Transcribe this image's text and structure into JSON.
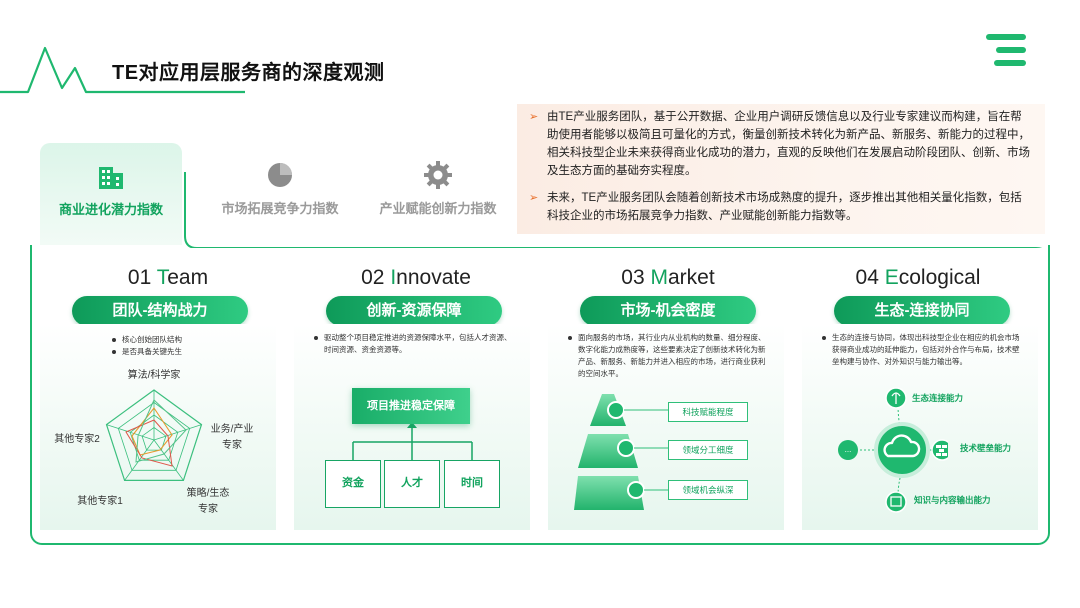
{
  "header": {
    "title": "TE对应用层服务商的深度观测"
  },
  "colors": {
    "brand_green": "#12a35e",
    "accent_orange": "#e86e2a",
    "inactive_gray": "#9a9a9a"
  },
  "tabs": [
    {
      "label": "商业进化潜力指数",
      "icon": "buildings-icon",
      "active": true
    },
    {
      "label": "市场拓展竞争力指数",
      "icon": "pie-chart-icon",
      "active": false
    },
    {
      "label": "产业赋能创新力指数",
      "icon": "gear-icon",
      "active": false
    }
  ],
  "info": {
    "paragraphs": [
      "由TE产业服务团队，基于公开数据、企业用户调研反馈信息以及行业专家建议而构建，旨在帮助使用者能够以极简且可量化的方式，衡量创新技术转化为新产品、新服务、新能力的过程中，相关科技型企业未来获得商业化成功的潜力，直观的反映他们在发展启动阶段团队、创新、市场及生态方面的基础夯实程度。",
      "未来，TE产业服务团队会随着创新技术市场成熟度的提升，逐步推出其他相关量化指数，包括科技企业的市场拓展竞争力指数、产业赋能创新能力指数等。"
    ]
  },
  "cards": [
    {
      "num": "01",
      "num_first": "T",
      "num_rest": "eam",
      "pill": "团队-结构战力",
      "bullets": [
        "核心创始团队结构",
        "是否具备关键先生"
      ],
      "radar_labels": [
        "算法/科学家",
        "业务/产业专家",
        "策略/生态专家",
        "其他专家1",
        "其他专家2"
      ]
    },
    {
      "num": "02",
      "num_first": "I",
      "num_rest": "nnovate",
      "pill": "创新-资源保障",
      "bullets": [
        "驱动整个项目稳定推进的资源保障水平，包括人才资源、时间资源、资金资源等。"
      ],
      "tree_top": "项目推进稳定保障",
      "tree_items": [
        "资金",
        "人才",
        "时间"
      ]
    },
    {
      "num": "03",
      "num_first": "M",
      "num_rest": "arket",
      "pill": "市场-机会密度",
      "bullets": [
        "面向服务的市场，其行业内从业机构的数量、细分程度、数字化能力成熟度等，这些要素决定了创新技术转化为新产品、新服务、新能力并进入相应的市场，进行商业获利的空间水平。"
      ],
      "levels": [
        "科技赋能程度",
        "领域分工细度",
        "领域机会纵深"
      ]
    },
    {
      "num": "04",
      "num_first": "E",
      "num_rest": "cological",
      "pill": "生态-连接协同",
      "bullets": [
        "生态的连接与协同，体现出科技型企业在相应的机会市场获得商业成功的延伸能力，包括对外合作与布局，技术壁垒构建与协作、对外知识与能力输出等。"
      ],
      "eco_items": [
        "生态连接能力",
        "技术壁垒能力",
        "知识与内容输出能力"
      ],
      "eco_left": "..."
    }
  ]
}
